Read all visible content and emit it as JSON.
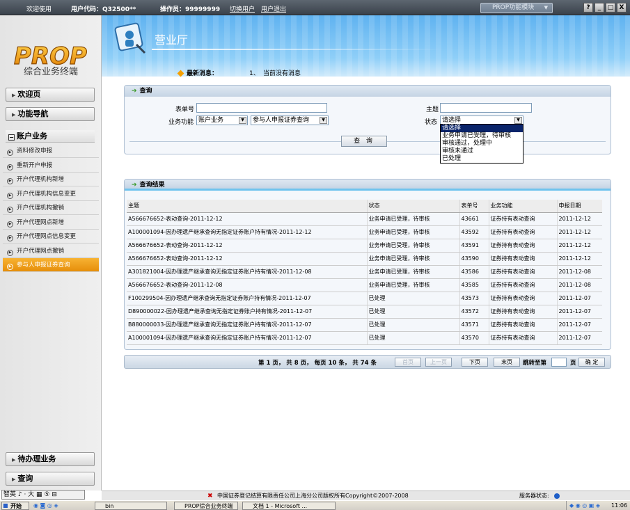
{
  "topbar": {
    "welcome": "欢迎使用",
    "user_code_label": "用户代码：Q32500**",
    "operator_label": "操作员：99999999",
    "switch_user": "切换用户",
    "logout": "用户退出",
    "module_select": "PROP功能模块",
    "window_buttons": [
      "?",
      "_",
      "□",
      "X"
    ]
  },
  "sidebar": {
    "logo_text": "PROP",
    "logo_subtitle": "综合业务终端",
    "welcome_page": "欢迎页",
    "function_nav": "功能导航",
    "account_business": "账户业务",
    "items": [
      "资料修改申报",
      "重新开户申报",
      "开户代理机构新增",
      "开户代理机构信息变更",
      "开户代理机构撤销",
      "开户代理网点新增",
      "开户代理网点信息变更",
      "开户代理网点撤销",
      "参与人申报证券查询"
    ],
    "active_item_index": 8,
    "pending_business": "待办理业务",
    "query": "查询"
  },
  "header": {
    "title": "营业厅",
    "news_label": "最新消息：",
    "news_index": "1、",
    "news_text": "当前没有消息"
  },
  "query_panel": {
    "title": "查询",
    "form_no_label": "表单号",
    "subject_label": "主题",
    "business_func_label": "业务功能",
    "business_func_value": "账户业务",
    "sub_func_value": "参与人申报证券查询",
    "status_label": "状态",
    "status_value": "请选择",
    "status_options": [
      "请选择",
      "业务申请已受理，待审核",
      "审核通过，处理中",
      "审核未通过",
      "已处理"
    ],
    "status_selected_index": 0,
    "query_button": "查 询"
  },
  "results_panel": {
    "title": "查询结果",
    "columns": [
      "主题",
      "状态",
      "表单号",
      "业务功能",
      "申报日期"
    ],
    "rows": [
      [
        "A566676652-表动查询-2011-12-12",
        "业务申请已受理，待审核",
        "43661",
        "证券持有表动查询",
        "2011-12-12"
      ],
      [
        "A100001094-因办理遗产继承查询无指定证券账户持有情况-2011-12-12",
        "业务申请已受理，待审核",
        "43592",
        "证券持有表动查询",
        "2011-12-12"
      ],
      [
        "A566676652-表动查询-2011-12-12",
        "业务申请已受理，待审核",
        "43591",
        "证券持有表动查询",
        "2011-12-12"
      ],
      [
        "A566676652-表动查询-2011-12-12",
        "业务申请已受理，待审核",
        "43590",
        "证券持有表动查询",
        "2011-12-12"
      ],
      [
        "A301821004-因办理遗产继承查询无指定证券账户持有情况-2011-12-08",
        "业务申请已受理，待审核",
        "43586",
        "证券持有表动查询",
        "2011-12-08"
      ],
      [
        "A566676652-表动查询-2011-12-08",
        "业务申请已受理，待审核",
        "43585",
        "证券持有表动查询",
        "2011-12-08"
      ],
      [
        "F100299504-因办理遗产继承查询无指定证券账户持有情况-2011-12-07",
        "已处理",
        "43573",
        "证券持有表动查询",
        "2011-12-07"
      ],
      [
        "D890000022-因办理遗产继承查询无指定证券账户持有情况-2011-12-07",
        "已处理",
        "43572",
        "证券持有表动查询",
        "2011-12-07"
      ],
      [
        "B880000033-因办理遗产继承查询无指定证券账户持有情况-2011-12-07",
        "已处理",
        "43571",
        "证券持有表动查询",
        "2011-12-07"
      ],
      [
        "A100001094-因办理遗产继承查询无指定证券账户持有情况-2011-12-07",
        "已处理",
        "43570",
        "证券持有表动查询",
        "2011-12-07"
      ]
    ]
  },
  "pager": {
    "summary": "第 1 页， 共 8 页， 每页 10 条， 共 74 条",
    "first": "首页",
    "prev": "上一页",
    "next": "下页",
    "last": "末页",
    "jump_label": "跳转至第",
    "page_unit": "页",
    "confirm": "确 定"
  },
  "footer": {
    "copyright": "中国证券登记结算有限责任公司上海分公司版权所有Copyright©2007-2008",
    "server_status_label": "服务器状态:",
    "ime_text": "智英 ♪ · 大 ▦ ⑤ ⊟"
  },
  "taskbar": {
    "start": "开始",
    "folder_task": "bin",
    "app_task": "PROP综合业务终端",
    "doc_task": "文档 1 - Microsoft ...",
    "time": "11:06"
  },
  "colors": {
    "accent_orange": "#f0a020",
    "header_blue": "#5fb2f0",
    "highlight_navy": "#0a246a"
  }
}
